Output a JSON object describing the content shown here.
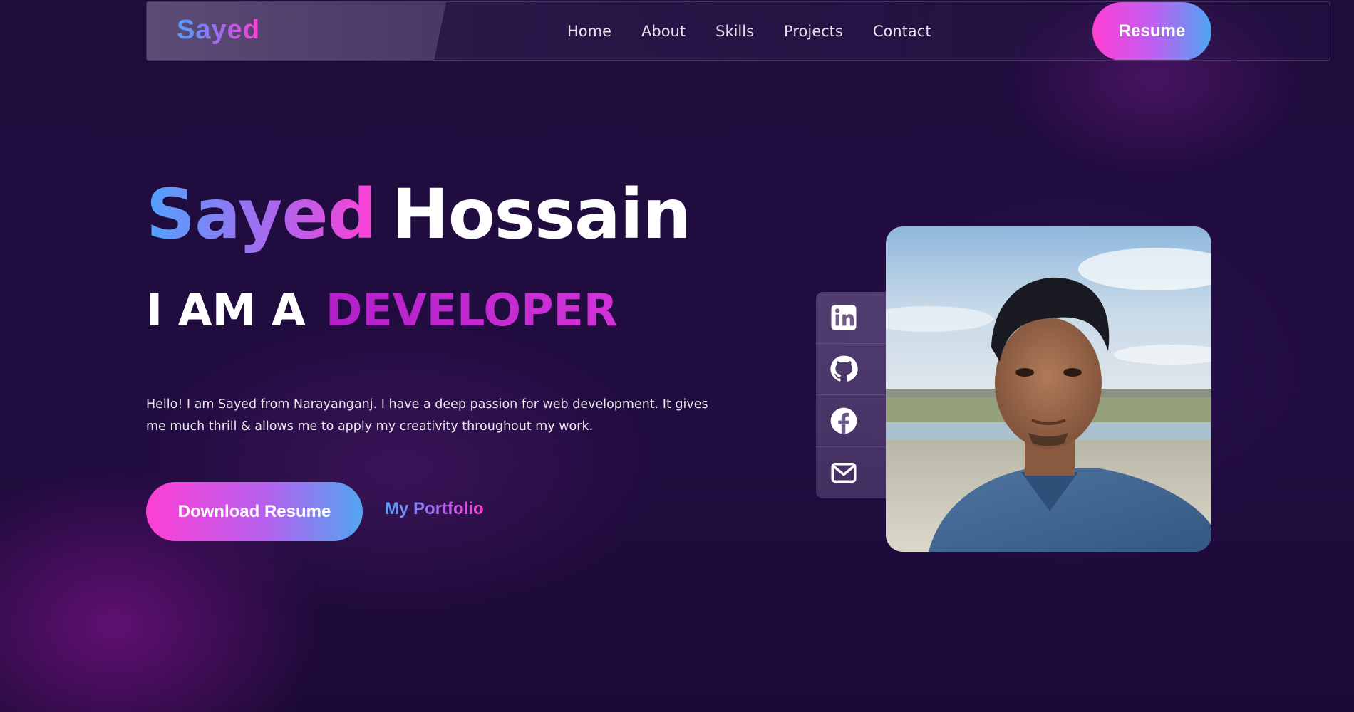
{
  "navbar": {
    "brand": "Sayed",
    "links": [
      "Home",
      "About",
      "Skills",
      "Projects",
      "Contact"
    ],
    "resume_label": "Resume"
  },
  "hero": {
    "name_first": "Sayed",
    "name_last": "Hossain",
    "role_prefix": "I AM A",
    "role_word": "DEVELOPER",
    "intro": "Hello! I am Sayed from Narayanganj. I have a deep passion for web development. It gives me much thrill & allows me to apply my creativity throughout my work.",
    "download_label": "Download Resume",
    "portfolio_label": "My Portfolio"
  },
  "social": {
    "icons": [
      "linkedin-icon",
      "github-icon",
      "facebook-icon",
      "mail-icon"
    ]
  },
  "photo": {
    "subject": "profile-photo"
  },
  "colors": {
    "background": "#210c40",
    "gradient_pink": "#ff3fd4",
    "gradient_purple": "#a868ee",
    "gradient_blue": "#4fa3ff",
    "role_magenta": "#c72ad0"
  }
}
